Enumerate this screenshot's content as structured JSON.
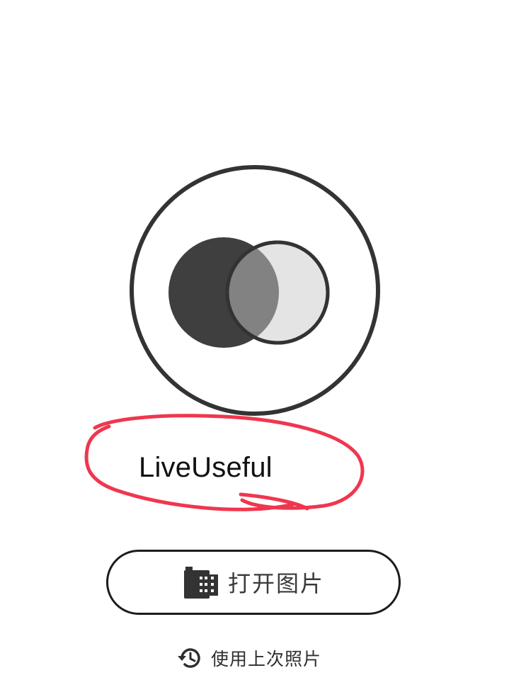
{
  "app": {
    "name": "LiveUseful"
  },
  "actions": {
    "open_image": {
      "label": "打开图片",
      "icon": "film-icon"
    },
    "use_last_photo": {
      "label": "使用上次照片",
      "icon": "history-icon"
    }
  },
  "colors": {
    "outline": "#333333",
    "dark_circle": "#3f3f3f",
    "overlap": "#828282",
    "light_circle": "#e4e4e4",
    "annotation": "#f0364e"
  }
}
